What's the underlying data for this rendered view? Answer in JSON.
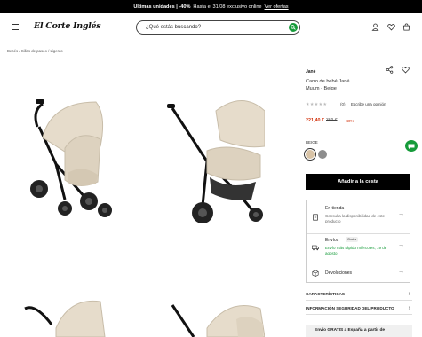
{
  "promo_bar": {
    "bold": "Últimas unidades | -40%",
    "text": "Hasta el 31/08 exclusivo online",
    "link": "Ver ofertas"
  },
  "header": {
    "logo": "El Corte Inglés",
    "search_placeholder": "¿Qué estás buscando?"
  },
  "breadcrumb": "Bebés / Sillas de paseo / Ligeras",
  "product": {
    "brand": "Jané",
    "title": "Carro de bebé Jané Muum - Beige",
    "rating_stars": "★★★★★",
    "rating_count": "(0)",
    "review_link": "Escribe una opinión",
    "price": "221,40 €",
    "old_price": "369 €",
    "discount": "-40%",
    "color_label": "BEIGE",
    "swatches": [
      "#d8c3a6",
      "#8d8d8d"
    ],
    "add_to_cart": "Añadir a la cesta"
  },
  "delivery": {
    "store_title": "En tienda",
    "store_sub": "Consulta la disponibilidad de este producto",
    "ship_title": "Envíos",
    "ship_badge": "Gratis",
    "ship_sub": "Envío más rápido miércoles, 19 de agosto",
    "returns_title": "Devoluciones"
  },
  "accordion": {
    "features": "CARACTERÍSTICAS",
    "safety": "INFORMACIÓN SEGURIDAD DEL PRODUCTO"
  },
  "promo_box": "Envío GRATIS a España a partir de",
  "colors": {
    "accent_green": "#169b3a",
    "price_red": "#d2300a"
  }
}
